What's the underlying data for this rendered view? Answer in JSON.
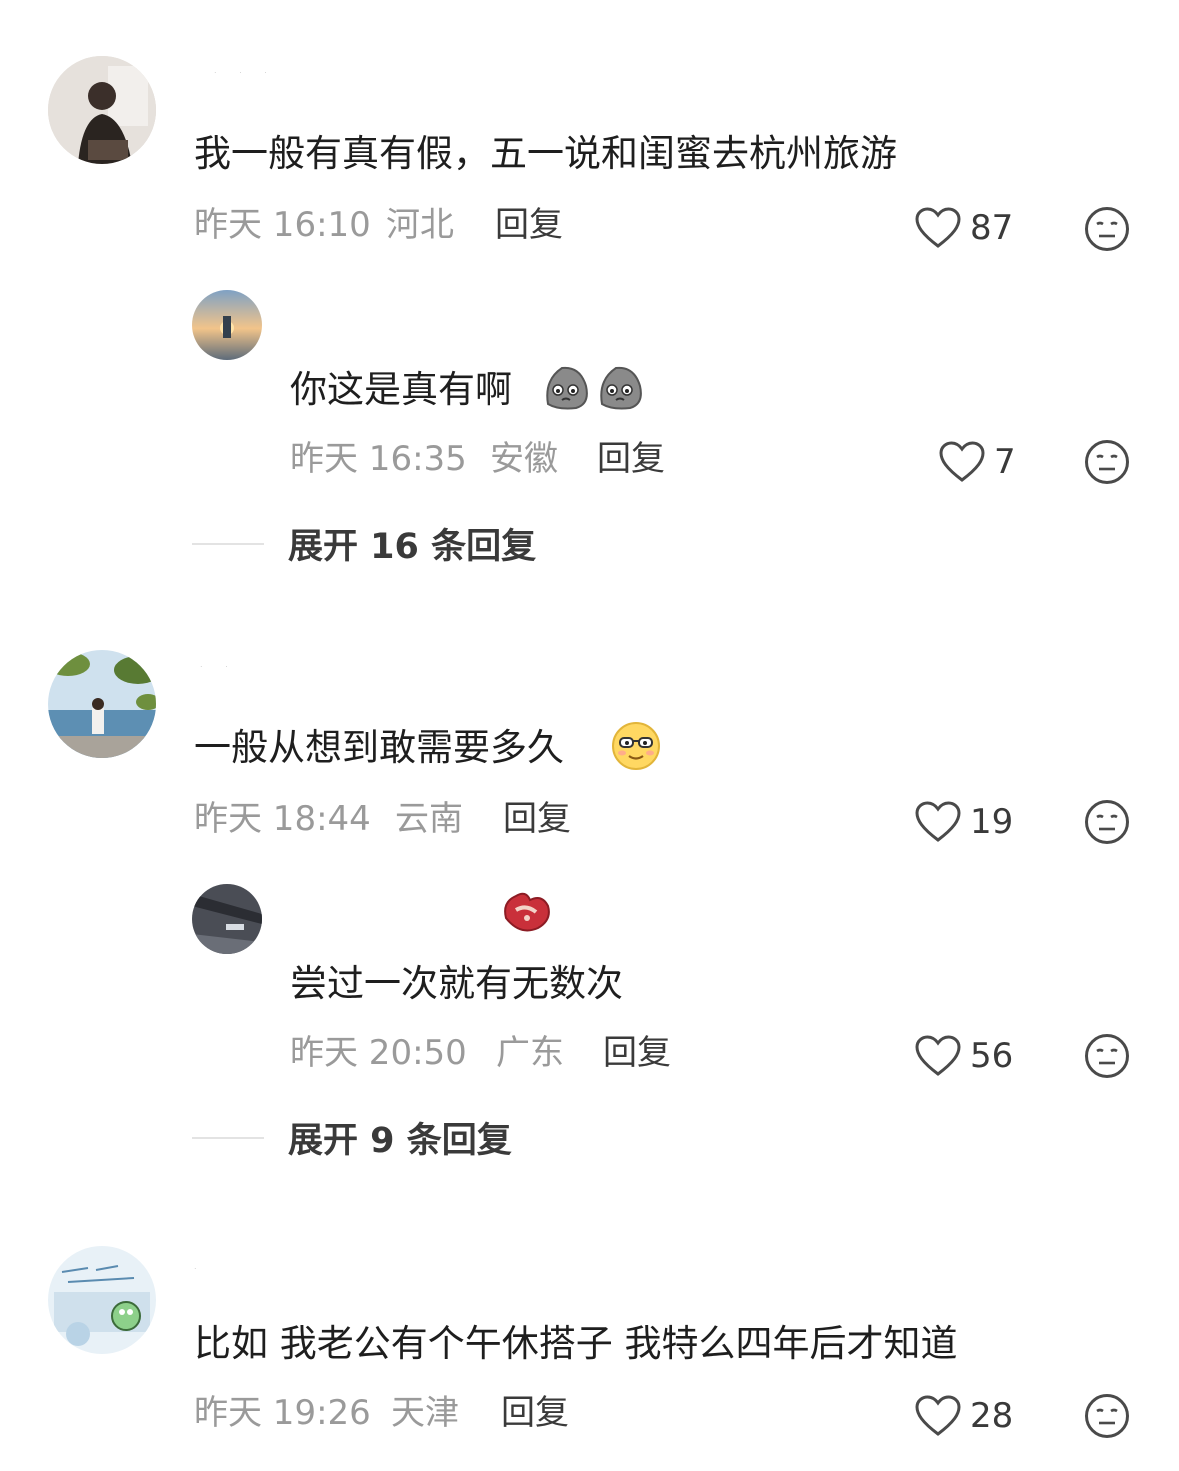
{
  "comments": [
    {
      "text": "我一般有真有假，五一说和闺蜜去杭州旅游",
      "time": "昨天 16:10",
      "location": "河北",
      "reply_label": "回复",
      "likes": "87",
      "replies": [
        {
          "text": "你这是真有啊",
          "time": "昨天 16:35",
          "location": "安徽",
          "reply_label": "回复",
          "likes": "7"
        }
      ],
      "expand_label": "展开 16 条回复"
    },
    {
      "text": "一般从想到敢需要多久",
      "time": "昨天 18:44",
      "location": "云南",
      "reply_label": "回复",
      "likes": "19",
      "replies": [
        {
          "text": "尝过一次就有无数次",
          "time": "昨天 20:50",
          "location": "广东",
          "reply_label": "回复",
          "likes": "56"
        }
      ],
      "expand_label": "展开 9 条回复"
    },
    {
      "text": "比如 我老公有个午休搭子 我特么四年后才知道",
      "time": "昨天 19:26",
      "location": "天津",
      "reply_label": "回复",
      "likes": "28"
    }
  ],
  "icons": {
    "like": "heart-outline-icon",
    "dislike": "neutral-face-icon",
    "emoji_rock": "rock-face-emoji",
    "emoji_glasses": "glasses-face-emoji",
    "emoji_steak": "steak-emoji"
  },
  "colors": {
    "meta_gray": "#9a9a9a",
    "text_dark": "#1e1e1e",
    "icon_gray": "#6f6f6f"
  }
}
